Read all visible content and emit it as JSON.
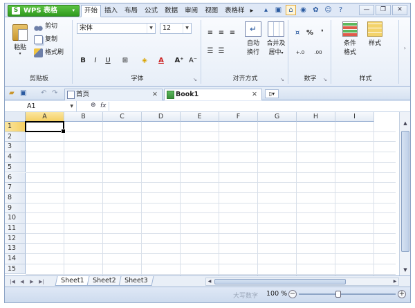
{
  "app": {
    "title": "WPS 表格",
    "logo_letter": "S",
    "caret": "▾"
  },
  "ribbon_tabs": [
    {
      "label": "开始",
      "active": true
    },
    {
      "label": "插入",
      "active": false
    },
    {
      "label": "布局",
      "active": false
    },
    {
      "label": "公式",
      "active": false
    },
    {
      "label": "数据",
      "active": false
    },
    {
      "label": "审阅",
      "active": false
    },
    {
      "label": "视图",
      "active": false
    },
    {
      "label": "表格样",
      "active": false
    }
  ],
  "ribbon_more": "▸",
  "window_controls": {
    "minimize": "—",
    "restore": "❐",
    "close": "✕"
  },
  "clipboard": {
    "paste": "粘贴",
    "cut": "剪切",
    "copy": "复制",
    "format_painter": "格式刷",
    "group_label": "剪贴板"
  },
  "font": {
    "name": "宋体",
    "size": "12",
    "bold": "B",
    "italic": "I",
    "underline": "U",
    "grow": "A⁺",
    "shrink": "A⁻",
    "group_label": "字体"
  },
  "alignment": {
    "wrap_l1": "自动",
    "wrap_l2": "换行",
    "merge_l1": "合并及",
    "merge_l2": "居中",
    "group_label": "对齐方式"
  },
  "number": {
    "percent": "%",
    "comma": "❜",
    "group_label": "数字"
  },
  "styles": {
    "cond_l1": "条件",
    "cond_l2": "格式",
    "style": "样式",
    "group_label": "样式"
  },
  "doc_tabs": [
    {
      "label": "首页",
      "active": false
    },
    {
      "label": "Book1",
      "active": true
    }
  ],
  "doc_tab_close": "✕",
  "formula_bar": {
    "cell_ref": "A1",
    "fx": "fx",
    "value": ""
  },
  "columns": [
    "A",
    "B",
    "C",
    "D",
    "E",
    "F",
    "G",
    "H",
    "I"
  ],
  "rows": [
    "1",
    "2",
    "3",
    "4",
    "5",
    "6",
    "7",
    "8",
    "9",
    "10",
    "11",
    "12",
    "13",
    "14",
    "15"
  ],
  "selected_cell": {
    "column": "A",
    "row": "1"
  },
  "sheets": [
    {
      "label": "Sheet1",
      "active": true
    },
    {
      "label": "Sheet2",
      "active": false
    },
    {
      "label": "Sheet3",
      "active": false
    }
  ],
  "status": {
    "caps": "大写数字",
    "zoom": "100 %",
    "zoom_percent": 100
  },
  "colors": {
    "accent": "#2f9a1e",
    "ribbon_bg": "#dfe8f6",
    "selection": "#f5cf63"
  }
}
